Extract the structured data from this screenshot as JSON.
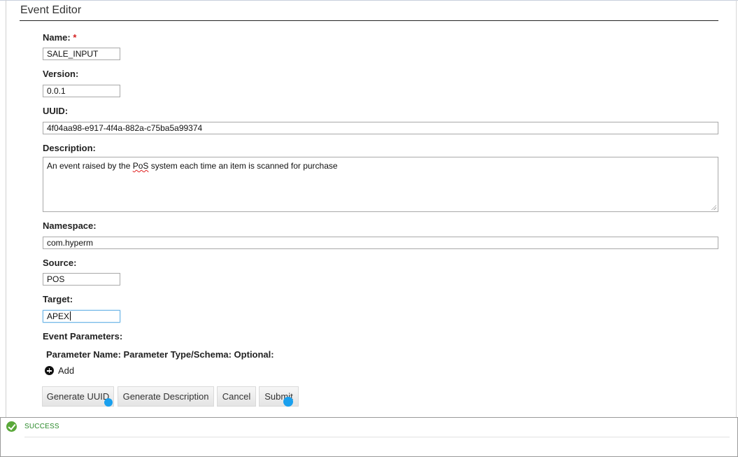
{
  "editor": {
    "title": "Event Editor",
    "fields": {
      "name": {
        "label": "Name:",
        "required_mark": "*",
        "value": "SALE_INPUT"
      },
      "version": {
        "label": "Version:",
        "value": "0.0.1"
      },
      "uuid": {
        "label": "UUID:",
        "value": "4f04aa98-e917-4f4a-882a-c75ba5a99374"
      },
      "description": {
        "label": "Description:",
        "value_before": "An event raised by the ",
        "value_flagged": "PoS",
        "value_after": " system each time an item is scanned for purchase"
      },
      "namespace": {
        "label": "Namespace:",
        "value": "com.hyperm"
      },
      "source": {
        "label": "Source:",
        "value": "POS"
      },
      "target": {
        "label": "Target:",
        "value": "APEX"
      }
    },
    "parameters": {
      "label": "Event Parameters:",
      "header": "Parameter Name: Parameter Type/Schema: Optional:",
      "add_label": "Add"
    },
    "buttons": {
      "generate_uuid": "Generate UUID",
      "generate_description": "Generate Description",
      "cancel": "Cancel",
      "submit": "Submit"
    }
  },
  "status": {
    "text": "SUCCESS",
    "icon": "check-circle-icon",
    "color": "#2a8a2a"
  },
  "colors": {
    "required": "#d32020",
    "focus_border": "#6fb6e6",
    "cursor_marker": "#1aa0ee"
  }
}
